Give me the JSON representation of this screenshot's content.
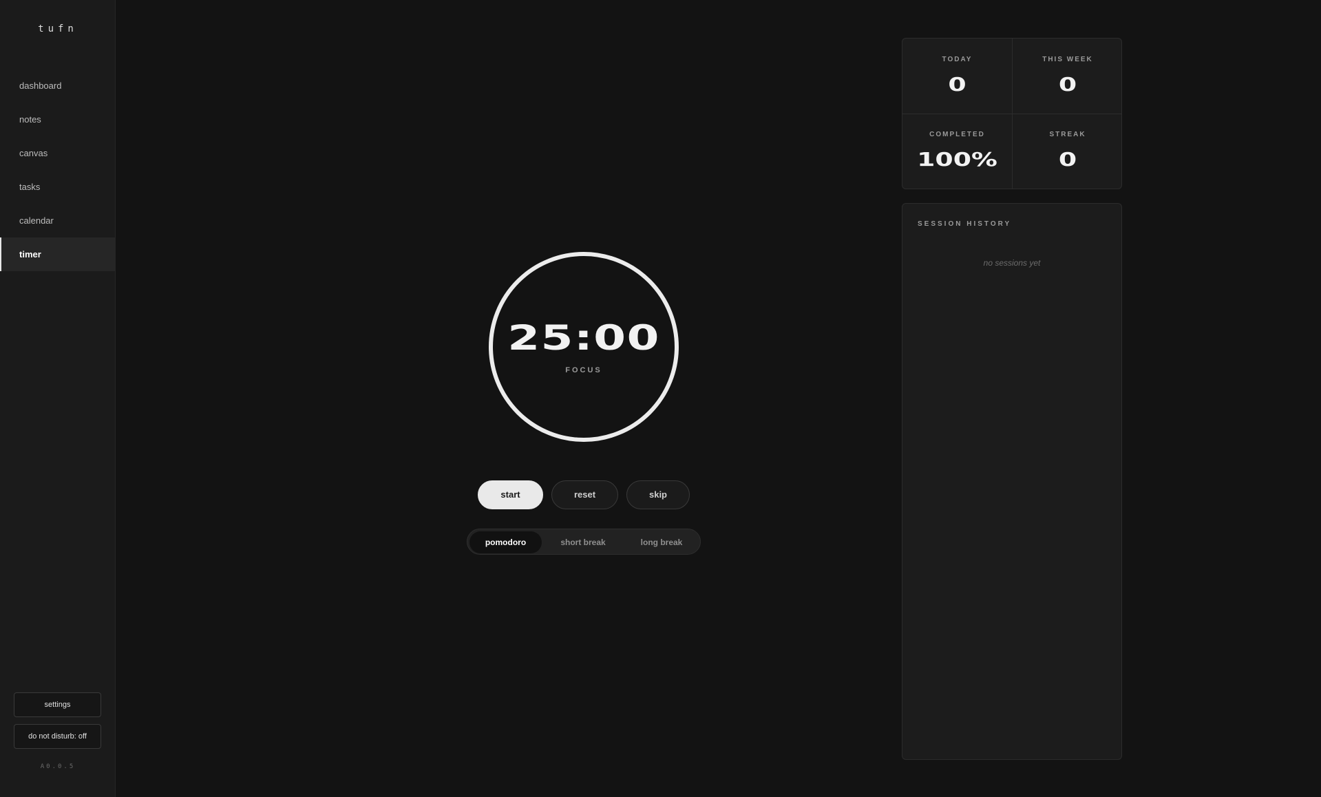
{
  "app": {
    "logo": "tufn",
    "version": "A0.0.5"
  },
  "sidebar": {
    "items": [
      {
        "label": "dashboard"
      },
      {
        "label": "notes"
      },
      {
        "label": "canvas"
      },
      {
        "label": "tasks"
      },
      {
        "label": "calendar"
      },
      {
        "label": "timer",
        "active": true
      }
    ],
    "settings_label": "settings",
    "dnd_label": "do not disturb: off"
  },
  "timer": {
    "time": "25:00",
    "mode": "FOCUS",
    "controls": {
      "start": "start",
      "reset": "reset",
      "skip": "skip"
    },
    "modes": {
      "pomodoro": "pomodoro",
      "short": "short break",
      "long": "long break",
      "selected": "pomodoro"
    }
  },
  "stats": {
    "today": {
      "label": "TODAY",
      "value": "0"
    },
    "week": {
      "label": "THIS WEEK",
      "value": "0"
    },
    "completed": {
      "label": "COMPLETED",
      "value": "100%"
    },
    "streak": {
      "label": "STREAK",
      "value": "0"
    }
  },
  "history": {
    "title": "SESSION HISTORY",
    "empty": "no sessions yet"
  },
  "colors": {
    "background": "#131313",
    "sidebar": "#1b1b1b",
    "accent": "#e9e9e9"
  }
}
